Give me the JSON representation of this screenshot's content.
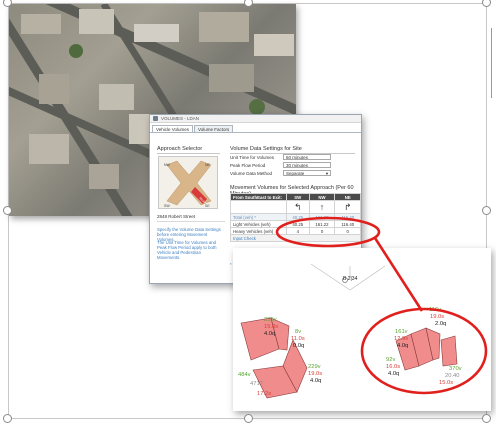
{
  "window": {
    "title": "VOLUMES - LDAN",
    "tabs": [
      "Vehicle Volumes",
      "Volume Factors"
    ]
  },
  "approach_selector": {
    "heading": "Approach Selector",
    "legs": [
      "NW",
      "NE",
      "SW",
      "SE"
    ],
    "selected": "SE",
    "site_name": "2848 Robert Street",
    "note1": "Specify the Volume Data Settings before entering Movement Volumes.",
    "note2": "The Unit Time for Volumes and Peak Flow Period apply to both Vehicle and Pedestrian Movements."
  },
  "settings": {
    "heading": "Volume Data Settings for Site",
    "unit_time_label": "Unit Time for Volumes",
    "unit_time_value": "60 minutes",
    "peak_flow_label": "Peak Flow Period",
    "peak_flow_value": "30 minutes",
    "method_label": "Volume Data Method",
    "method_value": "Separate"
  },
  "movement": {
    "heading": "Movement Volumes for Selected Approach (Per 60 Minutes)",
    "from_label": "From SouthEast to Exit:",
    "columns": [
      "SW",
      "NW",
      "NE"
    ],
    "rows": [
      {
        "label": "Total (veh) *",
        "values": [
          "40.25",
          "161.22",
          "116.40"
        ]
      },
      {
        "label": "Light Vehicles (veh)",
        "values": [
          "40.25",
          "161.22",
          "116.40"
        ]
      },
      {
        "label": "Heavy Vehicles (veh)",
        "values": [
          "4",
          "0",
          "0"
        ]
      }
    ],
    "input_check": "Input Check",
    "footnote": "* Total (veh) values are calculated from other vehicles specified"
  },
  "diagram": {
    "north_label": "N",
    "site_label": "B 2|34",
    "labels_left": {
      "a_green": "235v",
      "a_red": "15.0s",
      "a_black": "4.0q",
      "b_green": "8v",
      "b_red": "11.0s",
      "b_black": "0.0q",
      "c_green": "229v",
      "c_red": "19.0s",
      "c_black": "4.0q",
      "d_green": "484v",
      "d_gray": "4717",
      "d_red": "17.2s"
    },
    "labels_right": {
      "e_green": "116v",
      "e_red": "19.0s",
      "e_black": "2.0q",
      "f_green": "161v",
      "f_red": "12.9s",
      "f_black": "4.0q",
      "g_green": "92v",
      "g_red": "16.0s",
      "g_black": "4.0q",
      "h_green": "370v",
      "h_gray": "20.40",
      "h_red": "15.0s"
    }
  },
  "colors": {
    "highlight": "#e0201d",
    "bar_fill": "#f08c8c",
    "bar_stroke": "#8a3c3c"
  }
}
